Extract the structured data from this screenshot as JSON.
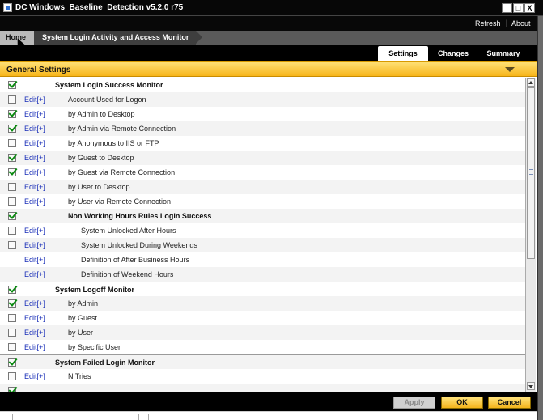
{
  "window": {
    "title": "DC Windows_Baseline_Detection v5.2.0 r75",
    "controls": {
      "minimize": "_",
      "maximize": "□",
      "close": "X"
    }
  },
  "topbar": {
    "refresh": "Refresh",
    "separator": "|",
    "about": "About"
  },
  "breadcrumb": {
    "home": "Home",
    "page": "System Login Activity and Access Monitor"
  },
  "tabs": [
    {
      "label": "Settings",
      "active": true
    },
    {
      "label": "Changes",
      "active": false
    },
    {
      "label": "Summary",
      "active": false
    }
  ],
  "section": {
    "title": "General Settings"
  },
  "rows": [
    {
      "label": "System Login Success Monitor",
      "checked": true,
      "checkbox": true,
      "edit": "",
      "bold": true,
      "indent": 1
    },
    {
      "label": "Account Used for Logon",
      "checked": false,
      "checkbox": true,
      "edit": "Edit[+]",
      "bold": false,
      "indent": 2
    },
    {
      "label": "by Admin to Desktop",
      "checked": true,
      "checkbox": true,
      "edit": "Edit[+]",
      "bold": false,
      "indent": 2
    },
    {
      "label": "by Admin via Remote Connection",
      "checked": true,
      "checkbox": true,
      "edit": "Edit[+]",
      "bold": false,
      "indent": 2
    },
    {
      "label": "by Anonymous to IIS or FTP",
      "checked": false,
      "checkbox": true,
      "edit": "Edit[+]",
      "bold": false,
      "indent": 2
    },
    {
      "label": "by Guest to Desktop",
      "checked": true,
      "checkbox": true,
      "edit": "Edit[+]",
      "bold": false,
      "indent": 2
    },
    {
      "label": "by Guest via Remote Connection",
      "checked": true,
      "checkbox": true,
      "edit": "Edit[+]",
      "bold": false,
      "indent": 2
    },
    {
      "label": "by User to Desktop",
      "checked": false,
      "checkbox": true,
      "edit": "Edit[+]",
      "bold": false,
      "indent": 2
    },
    {
      "label": "by User via Remote Connection",
      "checked": false,
      "checkbox": true,
      "edit": "Edit[+]",
      "bold": false,
      "indent": 2
    },
    {
      "label": "Non Working Hours Rules Login Success",
      "checked": true,
      "checkbox": true,
      "edit": "",
      "bold": true,
      "indent": 2
    },
    {
      "label": "System Unlocked After Hours",
      "checked": false,
      "checkbox": true,
      "edit": "Edit[+]",
      "bold": false,
      "indent": 3
    },
    {
      "label": "System Unlocked During Weekends",
      "checked": false,
      "checkbox": true,
      "edit": "Edit[+]",
      "bold": false,
      "indent": 3
    },
    {
      "label": "Definition of After Business Hours",
      "checked": false,
      "checkbox": false,
      "edit": "Edit[+]",
      "bold": false,
      "indent": 3
    },
    {
      "label": "Definition of Weekend Hours",
      "checked": false,
      "checkbox": false,
      "edit": "Edit[+]",
      "bold": false,
      "indent": 3
    },
    {
      "label": "System Logoff Monitor",
      "checked": true,
      "checkbox": true,
      "edit": "",
      "bold": true,
      "indent": 1,
      "group": true
    },
    {
      "label": "by Admin",
      "checked": true,
      "checkbox": true,
      "edit": "Edit[+]",
      "bold": false,
      "indent": 2
    },
    {
      "label": "by Guest",
      "checked": false,
      "checkbox": true,
      "edit": "Edit[+]",
      "bold": false,
      "indent": 2
    },
    {
      "label": "by User",
      "checked": false,
      "checkbox": true,
      "edit": "Edit[+]",
      "bold": false,
      "indent": 2
    },
    {
      "label": "by Specific User",
      "checked": false,
      "checkbox": true,
      "edit": "Edit[+]",
      "bold": false,
      "indent": 2
    },
    {
      "label": "System Failed Login Monitor",
      "checked": true,
      "checkbox": true,
      "edit": "",
      "bold": true,
      "indent": 1,
      "group": true
    },
    {
      "label": "N Tries",
      "checked": false,
      "checkbox": true,
      "edit": "Edit[+]",
      "bold": false,
      "indent": 2
    },
    {
      "label": "",
      "checked": true,
      "checkbox": true,
      "edit": "",
      "bold": false,
      "indent": 2
    }
  ],
  "buttons": {
    "apply": "Apply",
    "ok": "OK",
    "cancel": "Cancel"
  },
  "colors": {
    "accent": "#f7b51a",
    "link": "#1a2fb8",
    "check": "#0a8a10",
    "bar": "#000000"
  }
}
